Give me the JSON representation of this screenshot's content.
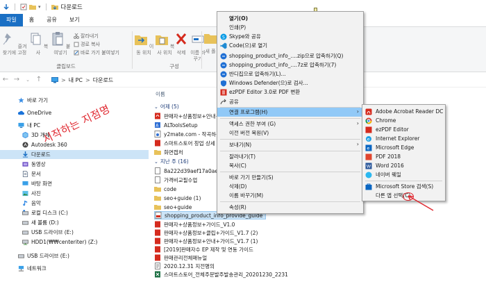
{
  "window": {
    "title": "다운로드"
  },
  "ribbon_tabs": [
    "파일",
    "홈",
    "공유",
    "보기"
  ],
  "ribbon": {
    "pin_label": "즐겨찾기에 고정",
    "copy_label": "복사",
    "paste_label": "붙여넣기",
    "cut_label": "잘라내기",
    "copy_path_label": "경로 복사",
    "paste_shortcut_label": "바로 가기 붙여넣기",
    "clipboard_group": "클립보드",
    "move_label": "이동 위치",
    "copyto_label": "복사 위치",
    "delete_label": "삭제",
    "rename_label": "이름 바꾸기",
    "new_label": "새 폴",
    "organize_group": "구성"
  },
  "address": {
    "parts": [
      "내 PC",
      "다운로드"
    ],
    "sep": ">"
  },
  "nav": {
    "items": [
      {
        "label": "바로 가기"
      },
      {
        "label": "OneDrive"
      },
      {
        "label": "내 PC"
      },
      {
        "label": "3D 개체"
      },
      {
        "label": "Autodesk 360"
      },
      {
        "label": "다운로드"
      },
      {
        "label": "동영상"
      },
      {
        "label": "문서"
      },
      {
        "label": "바탕 화면"
      },
      {
        "label": "사진"
      },
      {
        "label": "음악"
      },
      {
        "label": "로컬 디스크 (C:)"
      },
      {
        "label": "새 볼륨 (D:)"
      },
      {
        "label": "USB 드라이브 (E:)"
      },
      {
        "label": "HDD1(₩₩centeriter) (Z:)"
      },
      {
        "label": "USB 드라이브 (E:)"
      },
      {
        "label": "네트워크"
      }
    ]
  },
  "annotation_text": "시작하는 지점명",
  "files": {
    "column_name": "이름",
    "group_week": "어제 (5)",
    "group_last_week": "지난 주 (16)",
    "recent": [
      {
        "name": "판매자+상품정보+안내+..."
      },
      {
        "name": "ALToolsSetup"
      },
      {
        "name": "y2mate.com - 작곡하는"
      },
      {
        "name": "스마트스토어 창업 상세"
      },
      {
        "name": "화면캡처"
      }
    ],
    "older": [
      {
        "name": "8a222d39aef17a0ae99d6"
      },
      {
        "name": "가격비교필수업"
      },
      {
        "name": "code"
      },
      {
        "name": "seo+guide (1)"
      },
      {
        "name": "seo+guide"
      },
      {
        "name": "shopping_product_info_provide_guide"
      },
      {
        "name": "판매자+상품정보+가이드_V1.0"
      },
      {
        "name": "판매자+상품정보+클립+가이드_V1.7 (2)"
      },
      {
        "name": "판매자+상품정보+안내+가이드_V1.7 (1)"
      },
      {
        "name": "[2019]판매자수 EP 제작 및 연동 가이드"
      },
      {
        "name": "판매관리전체매뉴얼"
      },
      {
        "name": "2020.12.31 지전명의"
      },
      {
        "name": "스마트스토어_전체주문발주발송관리_20201230_2231"
      }
    ]
  },
  "context_menu": {
    "items": [
      {
        "label": "열기(O)",
        "bold": true
      },
      {
        "label": "인쇄(P)"
      },
      {
        "label": "Skype와 공유"
      },
      {
        "label": "Code(으)로 열기"
      },
      {
        "label": "shopping_product_info_....zip으로 압축하기(Q)"
      },
      {
        "label": "shopping_product_info_....7z로 압축하기(7)"
      },
      {
        "label": "반디집으로 압축하기(L)..."
      },
      {
        "label": "Windows Defender(으)로 검사..."
      },
      {
        "label": "ezPDF Editor 3.0로 PDF 변환"
      },
      {
        "label": "공유"
      },
      {
        "label": "연결 프로그램(H)"
      },
      {
        "label": "액세스 권한 부여 (G)"
      },
      {
        "label": "이전 버전 복원(V)"
      },
      {
        "label": "보내기(N)"
      },
      {
        "label": "잘라내기(T)"
      },
      {
        "label": "복사(C)"
      },
      {
        "label": "바로 가기 만들기(S)"
      },
      {
        "label": "삭제(D)"
      },
      {
        "label": "이름 바꾸기(M)"
      },
      {
        "label": "속성(R)"
      }
    ]
  },
  "submenu": {
    "items": [
      {
        "label": "Adobe Acrobat Reader DC"
      },
      {
        "label": "Chrome"
      },
      {
        "label": "ezPDF Editor"
      },
      {
        "label": "Internet Explorer"
      },
      {
        "label": "Microsoft Edge"
      },
      {
        "label": "PDF 2018"
      },
      {
        "label": "Word 2016"
      },
      {
        "label": "네이버 웨일"
      },
      {
        "label": "Microsoft Store 검색(S)"
      },
      {
        "label": "다른 앱 선택(C)"
      }
    ]
  },
  "colors": {
    "accent": "#1a6fc4",
    "selection": "#cce4f7",
    "menu_highlight": "#91c9f7",
    "annotation": "#e0272f"
  }
}
